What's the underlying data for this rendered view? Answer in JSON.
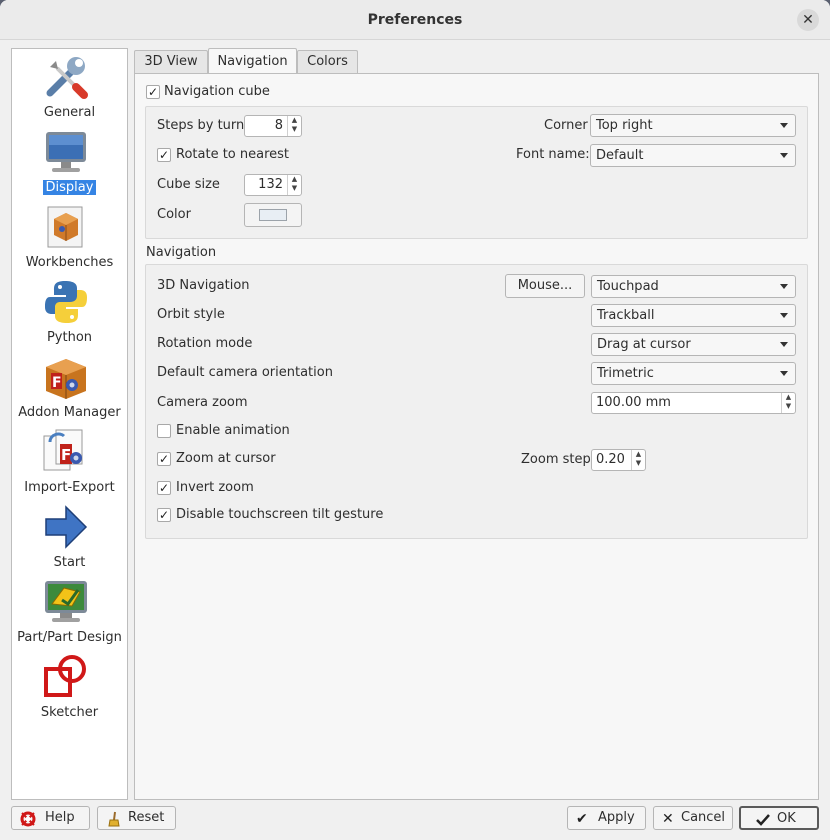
{
  "window": {
    "title": "Preferences"
  },
  "sidebar": {
    "items": [
      {
        "label": "General",
        "icon": "wrench-screwdriver-icon"
      },
      {
        "label": "Display",
        "icon": "monitor-icon",
        "selected": true
      },
      {
        "label": "Workbenches",
        "icon": "box-icon"
      },
      {
        "label": "Python",
        "icon": "python-icon"
      },
      {
        "label": "Addon Manager",
        "icon": "addon-box-icon"
      },
      {
        "label": "Import-Export",
        "icon": "import-export-icon"
      },
      {
        "label": "Start",
        "icon": "arrow-right-icon"
      },
      {
        "label": "Part/Part Design",
        "icon": "part-design-icon"
      },
      {
        "label": "Sketcher",
        "icon": "sketcher-icon"
      }
    ]
  },
  "tabs": [
    {
      "label": "3D View"
    },
    {
      "label": "Navigation",
      "active": true
    },
    {
      "label": "Colors"
    }
  ],
  "navcube": {
    "enabled_label": "Navigation cube",
    "enabled": true,
    "steps_label": "Steps by turn",
    "steps_value": "8",
    "rotate_label": "Rotate to nearest",
    "rotate_checked": true,
    "cube_size_label": "Cube size",
    "cube_size_value": "132",
    "color_label": "Color",
    "color_value": "#e8eef4",
    "corner_label": "Corner",
    "corner_value": "Top right",
    "font_label": "Font name:",
    "font_value": "Default"
  },
  "navigation": {
    "group_label": "Navigation",
    "nav3d_label": "3D Navigation",
    "mouse_button": "Mouse...",
    "nav3d_value": "Touchpad",
    "orbit_label": "Orbit style",
    "orbit_value": "Trackball",
    "rotation_label": "Rotation mode",
    "rotation_value": "Drag at cursor",
    "camera_orient_label": "Default camera orientation",
    "camera_orient_value": "Trimetric",
    "camera_zoom_label": "Camera zoom",
    "camera_zoom_value": "100.00 mm",
    "enable_anim_label": "Enable animation",
    "enable_anim_checked": false,
    "zoom_cursor_label": "Zoom at cursor",
    "zoom_cursor_checked": true,
    "zoom_step_label": "Zoom step",
    "zoom_step_value": "0.20",
    "invert_zoom_label": "Invert zoom",
    "invert_zoom_checked": true,
    "disable_tilt_label": "Disable touchscreen tilt gesture",
    "disable_tilt_checked": true
  },
  "buttons": {
    "help": "Help",
    "reset": "Reset",
    "apply": "Apply",
    "cancel": "Cancel",
    "ok": "OK"
  },
  "checkmark": "✓",
  "colors": {
    "accent": "#3584e4",
    "selected_text": "#ffffff"
  }
}
